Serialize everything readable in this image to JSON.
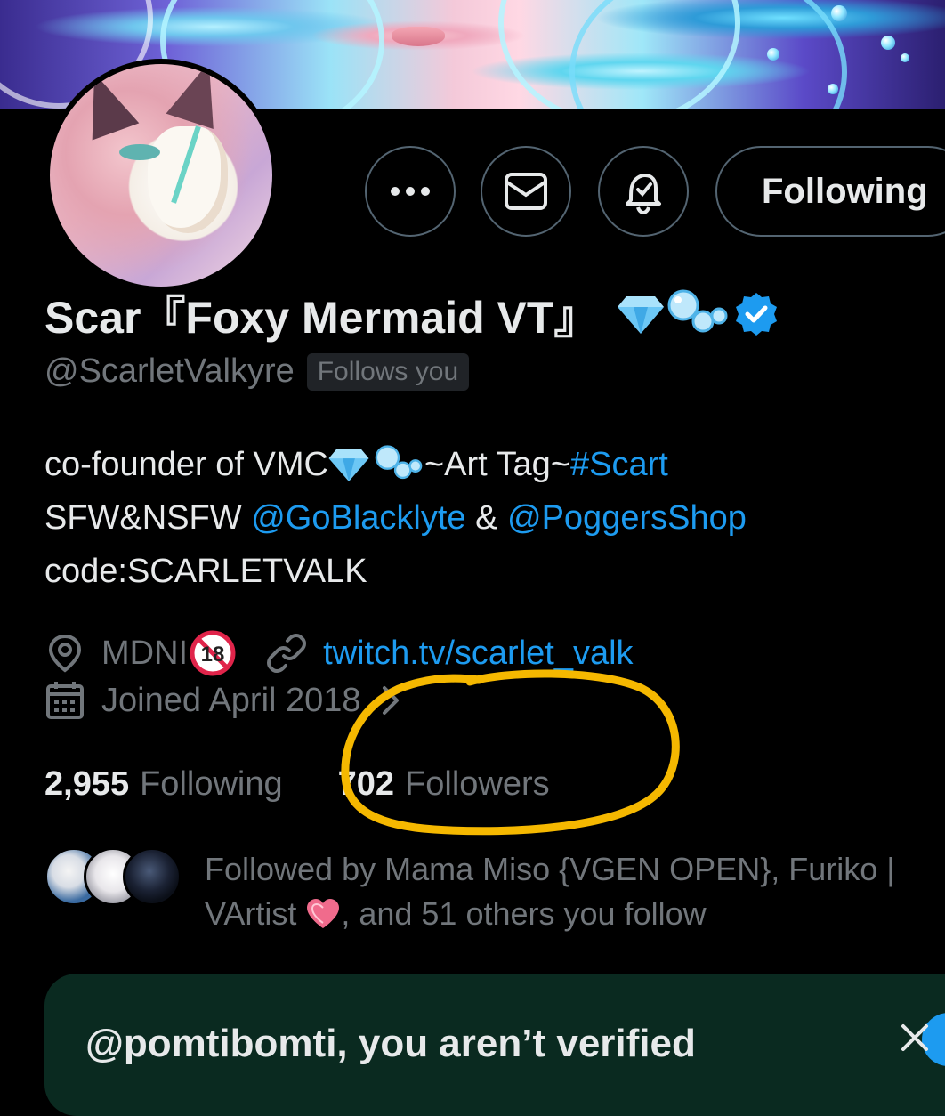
{
  "header": {
    "more_icon": "more-horizontal-icon",
    "message_icon": "envelope-icon",
    "notify_icon": "bell-check-icon",
    "follow_button_label": "Following"
  },
  "profile": {
    "display_name": "Scar『Foxy Mermaid VT』",
    "handle": "@ScarletValkyre",
    "follows_you_badge": "Follows you",
    "verified_color": "#1d9bf0",
    "bio": {
      "line1_prefix": "co-founder of VMC",
      "line1_mid": "~Art Tag~",
      "line1_hashtag": "#Scart",
      "line2_prefix": "SFW&NSFW ",
      "line2_mention1": "@GoBlacklyte",
      "line2_amp": " & ",
      "line2_mention2": "@PoggersShop",
      "line3": "code:SCARLETVALK"
    },
    "location": "MDNI",
    "website": "twitch.tv/scarlet_valk",
    "joined": "Joined April 2018"
  },
  "stats": {
    "following_count": "2,955",
    "following_label": "Following",
    "followers_count": "702",
    "followers_label": "Followers"
  },
  "followed_by": {
    "line1": "Followed by Mama Miso {VGEN OPEN}, Furiko |",
    "line2_prefix": "VArtist ",
    "line2_suffix": ", and 51 others you follow"
  },
  "verify_banner": {
    "title": "@pomtibomti, you aren’t verified"
  },
  "colors": {
    "background": "#000000",
    "text_primary": "#e7e9ea",
    "text_secondary": "#71767b",
    "link": "#1d9bf0",
    "annotation": "#f5b800"
  }
}
